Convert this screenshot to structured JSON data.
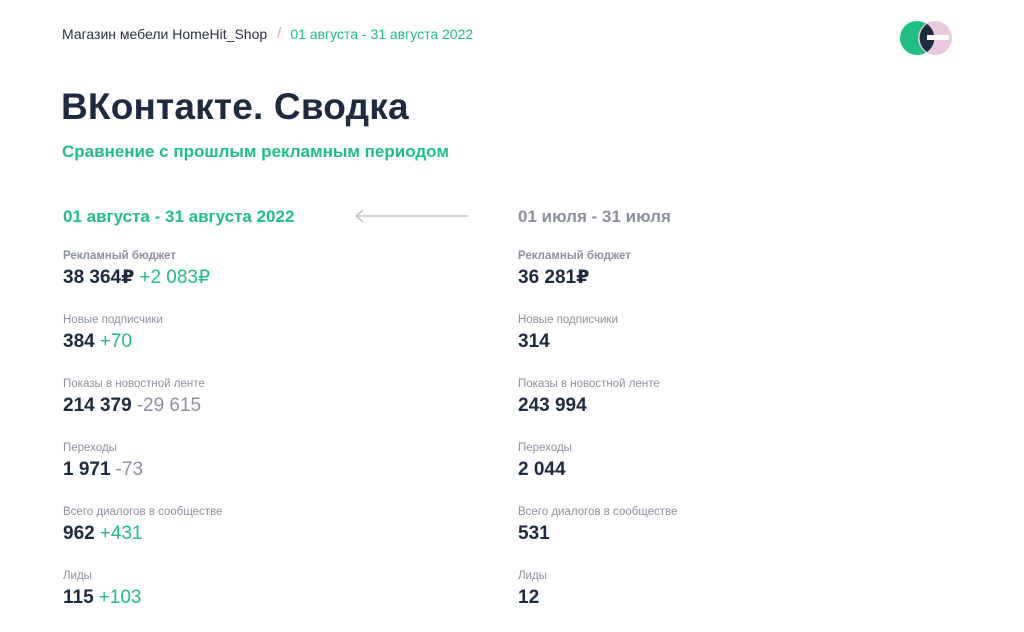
{
  "breadcrumb": {
    "shop": "Магазин мебели HomeHit_Shop",
    "separator": "/",
    "period": "01 августа - 31 августа 2022"
  },
  "title": "ВКонтакте. Сводка",
  "subtitle": "Сравнение с прошлым рекламным периодом",
  "current": {
    "period": "01 августа - 31 августа 2022",
    "metrics": [
      {
        "label": "Рекламный бюджет",
        "value": "38 364₽",
        "diff": "+2 083₽",
        "trend": "pos"
      },
      {
        "label": "Новые подписчики",
        "value": "384",
        "diff": "+70",
        "trend": "pos"
      },
      {
        "label": "Показы в новостной ленте",
        "value": "214 379",
        "diff": "-29 615",
        "trend": "neg"
      },
      {
        "label": "Переходы",
        "value": "1 971",
        "diff": "-73",
        "trend": "neg"
      },
      {
        "label": "Всего диалогов в сообществе",
        "value": "962",
        "diff": "+431",
        "trend": "pos"
      },
      {
        "label": "Лиды",
        "value": "115",
        "diff": "+103",
        "trend": "pos"
      }
    ]
  },
  "previous": {
    "period": "01 июля - 31 июля",
    "metrics": [
      {
        "label": "Рекламный бюджет",
        "value": "36 281₽"
      },
      {
        "label": "Новые подписчики",
        "value": "314"
      },
      {
        "label": "Показы в новостной ленте",
        "value": "243 994"
      },
      {
        "label": "Переходы",
        "value": "2 044"
      },
      {
        "label": "Всего диалогов в сообществе",
        "value": "531"
      },
      {
        "label": "Лиды",
        "value": "12"
      }
    ]
  },
  "colors": {
    "accent": "#1fbf84",
    "text": "#1d2a3f",
    "muted": "#8a909c",
    "logo_pink": "#eac9dc",
    "logo_navy": "#1d2a3f"
  },
  "icons": {
    "logo": "brand-logo-icon",
    "arrow": "arrow-left-icon"
  }
}
